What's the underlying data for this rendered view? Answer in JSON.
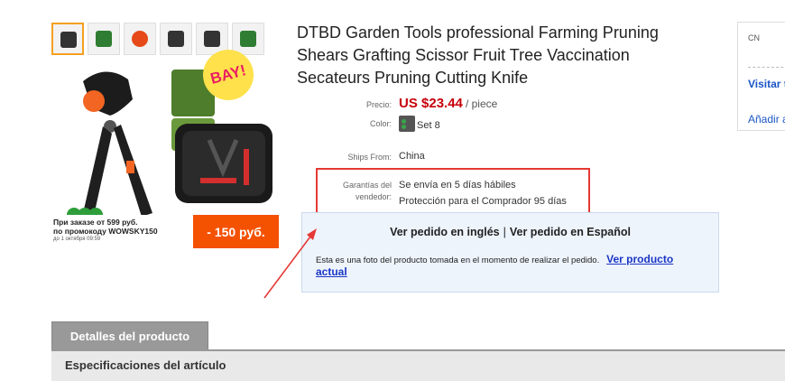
{
  "product": {
    "title": "DTBD Garden Tools professional Farming Pruning Shears Grafting Scissor Fruit Tree Vaccination Secateurs Pruning Cutting Knife",
    "image": {
      "badge_text": "BAY!",
      "promo_line1": "При заказе от 599 руб.",
      "promo_line2": "по промокоду WOWSKY150",
      "promo_line3": "до 1 октября 09:59",
      "promo_discount": "- 150 руб."
    }
  },
  "details": {
    "price_label": "Precio:",
    "price_value": "US $23.44",
    "price_unit": "/ piece",
    "color_label": "Color:",
    "color_value": "Set 8",
    "ships_label": "Ships From:",
    "ships_value": "China",
    "warranty_label_line1": "Garantías del",
    "warranty_label_line2": "vendedor:",
    "warranty_line1": "Se envía en 5 días hábiles",
    "warranty_line2": "Protección para el Comprador 95 días"
  },
  "notice": {
    "link_english": "Ver pedido en inglés",
    "separator": "|",
    "link_spanish": "Ver pedido en Español",
    "body_text": "Esta es una foto del producto tomada en el momento de realizar el pedido.",
    "current_link": "Ver producto actual"
  },
  "sidebar": {
    "country": "CN",
    "visit_link": "Visitar t",
    "add_link": "Añadir a"
  },
  "tabs": {
    "active_tab": "Detalles del producto",
    "specs_title": "Especificaciones del artículo"
  },
  "colors": {
    "price_red": "#c7000b",
    "highlight_red": "#e53935",
    "link_blue": "#1a36c5",
    "promo_orange": "#f45100"
  }
}
